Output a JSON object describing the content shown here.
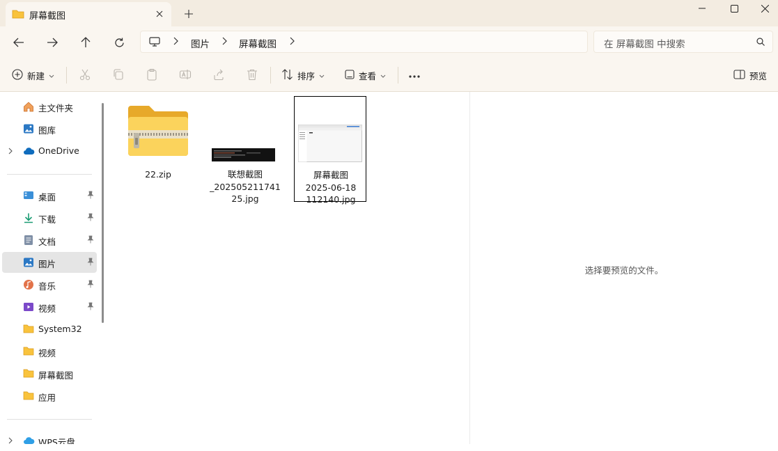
{
  "tab": {
    "title": "屏幕截图",
    "close_icon": "close-icon",
    "new_tab_icon": "plus-icon"
  },
  "window": {
    "minimize_icon": "minimize-icon",
    "maximize_icon": "maximize-icon",
    "close_icon": "close-icon"
  },
  "nav": {
    "back_icon": "arrow-left-icon",
    "forward_icon": "arrow-right-icon",
    "up_icon": "arrow-up-icon",
    "refresh_icon": "refresh-icon",
    "breadcrumb": [
      "图片",
      "屏幕截图"
    ],
    "search_placeholder": "在 屏幕截图 中搜索"
  },
  "toolbar": {
    "new_label": "新建",
    "sort_label": "排序",
    "view_label": "查看",
    "preview_label": "预览"
  },
  "sidebar": {
    "quick": [
      {
        "label": "主文件夹",
        "icon": "home-icon"
      },
      {
        "label": "图库",
        "icon": "gallery-icon"
      },
      {
        "label": "OneDrive",
        "icon": "cloud-icon"
      }
    ],
    "pinned": [
      {
        "label": "桌面",
        "icon": "desktop-icon"
      },
      {
        "label": "下载",
        "icon": "download-icon"
      },
      {
        "label": "文档",
        "icon": "document-icon"
      },
      {
        "label": "图片",
        "icon": "picture-icon"
      },
      {
        "label": "音乐",
        "icon": "music-icon"
      },
      {
        "label": "视频",
        "icon": "video-icon"
      },
      {
        "label": "System32",
        "icon": "folder-icon"
      },
      {
        "label": "视频",
        "icon": "folder-icon"
      },
      {
        "label": "屏幕截图",
        "icon": "folder-icon"
      },
      {
        "label": "应用",
        "icon": "folder-icon"
      }
    ],
    "bottom": [
      {
        "label": "WPS云盘",
        "icon": "cloud-icon"
      }
    ]
  },
  "files": [
    {
      "name": "22.zip",
      "type": "zip"
    },
    {
      "name": "联想截图\n_202505211741\n25.jpg",
      "type": "image-dark"
    },
    {
      "name": "屏幕截图\n2025-06-18\n112140.jpg",
      "type": "image-light"
    }
  ],
  "preview": {
    "message": "选择要预览的文件。"
  },
  "colors": {
    "titlebar": "#f3ece1",
    "toolbar": "#faf6f0",
    "folder": "#f9c33d",
    "accent": "#0078d4"
  }
}
